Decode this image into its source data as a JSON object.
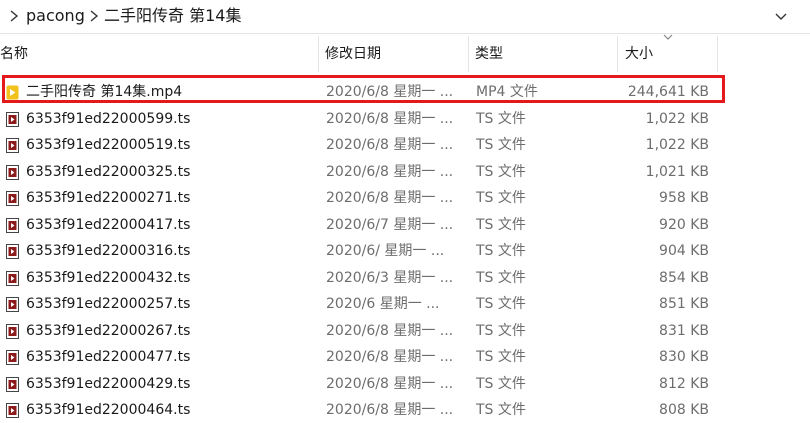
{
  "breadcrumb": {
    "segment1": "pacong",
    "segment2": "二手阳传奇 第14集"
  },
  "columns": {
    "name": "名称",
    "date": "修改日期",
    "type": "类型",
    "size": "大小"
  },
  "files": [
    {
      "name": "二手阳传奇 第14集.mp4",
      "date": "2020/6/8 星期一 ...",
      "type": "MP4 文件",
      "size": "244,641 KB",
      "kind": "mp4"
    },
    {
      "name": "6353f91ed22000599.ts",
      "date": "2020/6/8 星期一 ...",
      "type": "TS 文件",
      "size": "1,022 KB",
      "kind": "ts"
    },
    {
      "name": "6353f91ed22000519.ts",
      "date": "2020/6/8 星期一 ...",
      "type": "TS 文件",
      "size": "1,022 KB",
      "kind": "ts"
    },
    {
      "name": "6353f91ed22000325.ts",
      "date": "2020/6/8 星期一 ...",
      "type": "TS 文件",
      "size": "1,021 KB",
      "kind": "ts"
    },
    {
      "name": "6353f91ed22000271.ts",
      "date": "2020/6/8 星期一 ...",
      "type": "TS 文件",
      "size": "958 KB",
      "kind": "ts"
    },
    {
      "name": "6353f91ed22000417.ts",
      "date": "2020/6/7 星期一 ...",
      "type": "TS 文件",
      "size": "920 KB",
      "kind": "ts"
    },
    {
      "name": "6353f91ed22000316.ts",
      "date": "2020/6/ 星期一 ...",
      "type": "TS 文件",
      "size": "904 KB",
      "kind": "ts"
    },
    {
      "name": "6353f91ed22000432.ts",
      "date": "2020/6/3 星期一 ...",
      "type": "TS 文件",
      "size": "854 KB",
      "kind": "ts"
    },
    {
      "name": "6353f91ed22000257.ts",
      "date": "2020/6 星期一 ...",
      "type": "TS 文件",
      "size": "851 KB",
      "kind": "ts"
    },
    {
      "name": "6353f91ed22000267.ts",
      "date": "2020/6/8 星期一 ...",
      "type": "TS 文件",
      "size": "831 KB",
      "kind": "ts"
    },
    {
      "name": "6353f91ed22000477.ts",
      "date": "2020/6/8 星期一 ...",
      "type": "TS 文件",
      "size": "830 KB",
      "kind": "ts"
    },
    {
      "name": "6353f91ed22000429.ts",
      "date": "2020/6/8 星期一 ...",
      "type": "TS 文件",
      "size": "812 KB",
      "kind": "ts"
    },
    {
      "name": "6353f91ed22000464.ts",
      "date": "2020/6/8 星期一 ...",
      "type": "TS 文件",
      "size": "808 KB",
      "kind": "ts"
    }
  ],
  "colors": {
    "highlight": "#e3191c",
    "mp4_icon": "#f1c21b",
    "ts_icon": "#8b1a1a"
  },
  "icons": {
    "breadcrumb_separator": "chevron-right-icon",
    "expand": "chevron-down-icon",
    "sort": "sort-caret-icon",
    "mp4_file": "video-file-icon",
    "ts_file": "media-file-icon"
  }
}
